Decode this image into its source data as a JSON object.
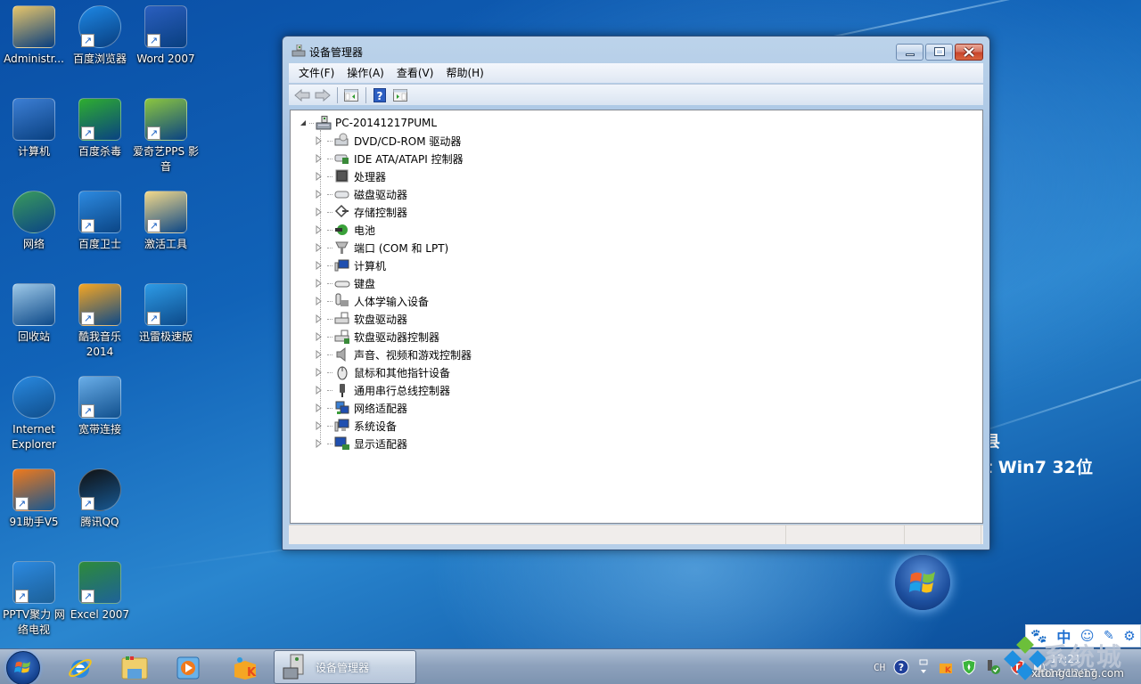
{
  "desktop": {
    "icons": [
      {
        "label": "Administr...",
        "icon": "user-folder-icon"
      },
      {
        "label": "百度浏览器",
        "icon": "baidu-browser-icon"
      },
      {
        "label": "Word 2007",
        "icon": "word-icon"
      },
      {
        "label": "计算机",
        "icon": "computer-icon"
      },
      {
        "label": "百度杀毒",
        "icon": "baidu-antivirus-icon"
      },
      {
        "label": "爱奇艺PPS 影音",
        "icon": "iqiyi-pps-icon"
      },
      {
        "label": "网络",
        "icon": "network-icon"
      },
      {
        "label": "百度卫士",
        "icon": "baidu-guard-icon"
      },
      {
        "label": "激活工具",
        "icon": "folder-icon"
      },
      {
        "label": "回收站",
        "icon": "recycle-bin-icon"
      },
      {
        "label": "酷我音乐 2014",
        "icon": "kuwo-music-icon"
      },
      {
        "label": "迅雷极速版",
        "icon": "thunder-icon"
      },
      {
        "label": "Internet Explorer",
        "icon": "ie-icon"
      },
      {
        "label": "宽带连接",
        "icon": "broadband-icon"
      },
      {
        "label": "91助手V5",
        "icon": "91-assistant-icon"
      },
      {
        "label": "腾讯QQ",
        "icon": "qq-icon"
      },
      {
        "label": "PPTV聚力 网络电视",
        "icon": "pptv-icon"
      },
      {
        "label": "Excel 2007",
        "icon": "excel-icon"
      }
    ],
    "wallpaper_text": {
      "line1": "县",
      "line2": "t Win7 32位"
    }
  },
  "window": {
    "title": "设备管理器",
    "menu": [
      "文件(F)",
      "操作(A)",
      "查看(V)",
      "帮助(H)"
    ],
    "toolbar": [
      "back",
      "forward",
      "show-hide-console-tree",
      "help",
      "show-hide-action-pane"
    ],
    "tree": {
      "root": "PC-20141217PUML",
      "items": [
        {
          "label": "DVD/CD-ROM 驱动器",
          "icon": "dvd-drive-icon"
        },
        {
          "label": "IDE ATA/ATAPI 控制器",
          "icon": "ide-controller-icon"
        },
        {
          "label": "处理器",
          "icon": "processor-icon"
        },
        {
          "label": "磁盘驱动器",
          "icon": "disk-drive-icon"
        },
        {
          "label": "存储控制器",
          "icon": "storage-controller-icon"
        },
        {
          "label": "电池",
          "icon": "battery-icon"
        },
        {
          "label": "端口 (COM 和 LPT)",
          "icon": "port-icon"
        },
        {
          "label": "计算机",
          "icon": "computer-icon"
        },
        {
          "label": "键盘",
          "icon": "keyboard-icon"
        },
        {
          "label": "人体学输入设备",
          "icon": "hid-icon"
        },
        {
          "label": "软盘驱动器",
          "icon": "floppy-drive-icon"
        },
        {
          "label": "软盘驱动器控制器",
          "icon": "floppy-controller-icon"
        },
        {
          "label": "声音、视频和游戏控制器",
          "icon": "sound-icon"
        },
        {
          "label": "鼠标和其他指针设备",
          "icon": "mouse-icon"
        },
        {
          "label": "通用串行总线控制器",
          "icon": "usb-icon"
        },
        {
          "label": "网络适配器",
          "icon": "network-adapter-icon"
        },
        {
          "label": "系统设备",
          "icon": "system-device-icon"
        },
        {
          "label": "显示适配器",
          "icon": "display-adapter-icon"
        }
      ]
    }
  },
  "taskbar": {
    "pinned": [
      "ie-icon",
      "explorer-icon",
      "media-player-icon",
      "kuwo-music-icon"
    ],
    "active_task": "设备管理器",
    "tray": {
      "language": "CH",
      "time": "17:21",
      "date": "2014/12/17"
    },
    "ime": [
      "paw-icon",
      "中",
      "smiley-icon",
      "pen-icon",
      "gear-icon"
    ]
  },
  "watermark": {
    "site": "系统城",
    "url": "xitongcheng.com"
  }
}
